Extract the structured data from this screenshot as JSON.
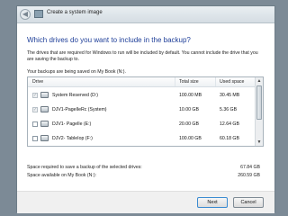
{
  "window": {
    "title": "Create a system image",
    "back_glyph": "◀"
  },
  "page": {
    "heading": "Which drives do you want to include in the backup?",
    "description": "The drives that are required for Windows to run will be included by default. You cannot include the drive that you are saving the backup to.",
    "location": "Your backups are being saved on My Book (N:)."
  },
  "grid": {
    "columns": [
      "Drive",
      "Total size",
      "Used space"
    ],
    "rows": [
      {
        "name": "System Reserved (D:)",
        "total": "100.00 MB",
        "used": "30.45 MB",
        "checked": true,
        "disabled": true
      },
      {
        "name": "DJV1-PageIleRc (System)",
        "total": "10.00 GB",
        "used": "5.36 GB",
        "checked": true,
        "disabled": true
      },
      {
        "name": "DJV1- PageIle (E:)",
        "total": "20.00 GB",
        "used": "12.64 GB",
        "checked": false,
        "disabled": false
      },
      {
        "name": "DJV2- TableIop (F:)",
        "total": "100.00 GB",
        "used": "60.18 GB",
        "checked": false,
        "disabled": false
      }
    ],
    "check_glyph": "✓"
  },
  "summary": {
    "required_label": "Space required to save a backup of the selected drives:",
    "required_value": "67.84 GB",
    "available_label": "Space available on My Book (N:):",
    "available_value": "260.59 GB"
  },
  "footer": {
    "next_label": "Next",
    "cancel_label": "Cancel"
  },
  "icons": {
    "back": "back-arrow-icon",
    "app": "backup-app-icon",
    "drive": "drive-icon",
    "scroll_up": "▲",
    "scroll_down": "▼"
  }
}
